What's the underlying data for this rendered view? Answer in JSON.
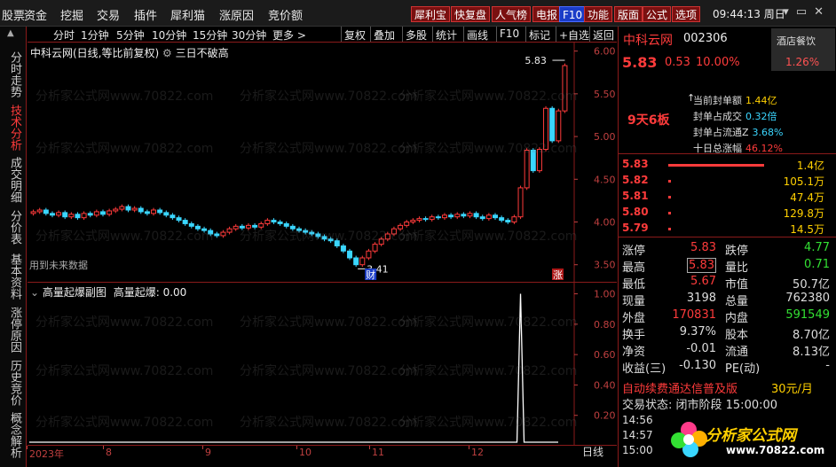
{
  "menu": [
    "股票",
    "资金",
    "挖掘",
    "交易",
    "插件",
    "犀利猫",
    "涨原因",
    "竞价额"
  ],
  "top_buttons": [
    {
      "label": "犀利宝",
      "style": "red"
    },
    {
      "label": "快复盘",
      "style": "red"
    },
    {
      "label": "人气榜",
      "style": "red"
    },
    {
      "label": "电报",
      "style": "red"
    },
    {
      "label": "F10",
      "style": "blue"
    },
    {
      "label": "功能",
      "style": "red"
    },
    {
      "label": "版面",
      "style": "red"
    },
    {
      "label": "公式",
      "style": "red"
    },
    {
      "label": "选项",
      "style": "red"
    }
  ],
  "clock": "09:44:13 周日",
  "sidebar": [
    "分时走势",
    "技术分析",
    "成交明细",
    "分价表",
    "基本资料",
    "涨停原因",
    "历史竞价",
    "概念解析"
  ],
  "sidebar_active": 1,
  "chart_toolbar": {
    "periods": [
      "分时",
      "1分钟",
      "5分钟",
      "10分钟",
      "15分钟",
      "30分钟",
      "更多 >"
    ],
    "actions": [
      "复权",
      "叠加",
      "多股",
      "统计",
      "画线",
      "F10",
      "标记",
      "+自选",
      "返回"
    ]
  },
  "chart": {
    "title": "中科云网(日线,等比前复权)",
    "indicator_label": "三日不破高",
    "future_label": "用到未来数据",
    "high_marker": "5.83",
    "low_marker": "3.41",
    "cai_badge": "财",
    "zhang_badge": "涨",
    "price_ticks": [
      "6.00",
      "5.50",
      "5.00",
      "4.50",
      "4.00",
      "3.50"
    ],
    "ind_title": "高量起爆副图",
    "ind_value_label": "高量起爆: 0.00",
    "ind_ticks": [
      "1.00",
      "0.80",
      "0.60",
      "0.40",
      "0.20"
    ],
    "x_labels": [
      "2023年",
      "8",
      "9",
      "10",
      "11",
      "12"
    ],
    "day_button": "日线",
    "watermark": "分析家公式网www.70822.com"
  },
  "chart_data": {
    "type": "candlestick",
    "title": "中科云网(日线,等比前复权)",
    "ylim": [
      3.3,
      6.1
    ],
    "close": [
      4.12,
      4.14,
      4.1,
      4.08,
      4.11,
      4.06,
      4.09,
      4.05,
      4.1,
      4.08,
      4.12,
      4.09,
      4.13,
      4.15,
      4.18,
      4.14,
      4.16,
      4.12,
      4.1,
      4.14,
      4.11,
      4.08,
      4.05,
      4.02,
      3.98,
      3.95,
      3.92,
      3.9,
      3.86,
      3.84,
      3.88,
      3.92,
      3.95,
      3.93,
      3.96,
      3.94,
      3.98,
      4.02,
      4.0,
      3.98,
      3.95,
      3.92,
      3.9,
      3.88,
      3.86,
      3.83,
      3.8,
      3.78,
      3.72,
      3.66,
      3.58,
      3.5,
      3.58,
      3.66,
      3.74,
      3.8,
      3.86,
      3.92,
      3.96,
      4.0,
      4.02,
      4.04,
      4.03,
      4.06,
      4.05,
      4.08,
      4.06,
      4.09,
      4.07,
      4.1,
      4.06,
      4.04,
      4.08,
      4.05,
      4.02,
      4.0,
      4.06,
      4.4,
      4.84,
      4.6,
      4.85,
      5.33,
      4.95,
      5.3,
      5.83
    ],
    "high_marker": 5.83,
    "low_marker": 3.41,
    "indicator": {
      "name": "高量起爆",
      "spike_at_index": 77,
      "spike_value": 1.0,
      "ylim": [
        0,
        1.05
      ]
    }
  },
  "quote": {
    "name": "中科云网",
    "code": "002306",
    "sector": "酒店餐饮",
    "sector_pct": "1.26%",
    "price": "5.83",
    "change": "0.53",
    "change_pct": "10.00%",
    "board": "9天6板",
    "seal": [
      {
        "label": "当前封单额",
        "value": "1.44亿",
        "color": "yellow"
      },
      {
        "label": "封单占成交",
        "value": "0.32倍",
        "color": "cyan"
      },
      {
        "label": "封单占流通Z",
        "value": "3.68%",
        "color": "cyan"
      },
      {
        "label": "十日总涨幅",
        "value": "46.12%",
        "color": "red"
      }
    ],
    "orderbook": [
      {
        "price": "5.83",
        "vol": "1.4亿",
        "bar": 1.0
      },
      {
        "price": "5.82",
        "vol": "105.1万",
        "bar": 0.02
      },
      {
        "price": "5.81",
        "vol": "47.4万",
        "bar": 0.02
      },
      {
        "price": "5.80",
        "vol": "129.8万",
        "bar": 0.02
      },
      {
        "price": "5.79",
        "vol": "14.5万",
        "bar": 0.02
      }
    ],
    "stats": [
      {
        "l1": "涨停",
        "v1": "5.83",
        "c1": "red",
        "l2": "跌停",
        "v2": "4.77",
        "c2": "green"
      },
      {
        "l1": "最高",
        "v1": "5.83",
        "c1": "red",
        "boxed1": true,
        "l2": "量比",
        "v2": "0.71",
        "c2": "green"
      },
      {
        "l1": "最低",
        "v1": "5.67",
        "c1": "red",
        "l2": "市值",
        "v2": "50.7亿",
        "c2": ""
      },
      {
        "l1": "现量",
        "v1": "3198",
        "c1": "",
        "l2": "总量",
        "v2": "762380",
        "c2": ""
      },
      {
        "l1": "外盘",
        "v1": "170831",
        "c1": "red",
        "l2": "内盘",
        "v2": "591549",
        "c2": "green"
      },
      {
        "l1": "换手",
        "v1": "9.37%",
        "c1": "",
        "l2": "股本",
        "v2": "8.70亿",
        "c2": ""
      },
      {
        "l1": "净资",
        "v1": "-0.01",
        "c1": "",
        "l2": "流通",
        "v2": "8.13亿",
        "c2": ""
      },
      {
        "l1": "收益(三)",
        "v1": "-0.130",
        "c1": "",
        "l2": "PE(动)",
        "v2": "-",
        "c2": ""
      }
    ],
    "promo": "自动续费通达信普及版",
    "promo_price": "30元/月",
    "trade_status": "交易状态: 闭市阶段 15:00:00",
    "ticks": [
      "14:56",
      "14:57",
      "15:00"
    ]
  },
  "logo": {
    "text": "分析家公式网",
    "url": "www.70822.com"
  }
}
